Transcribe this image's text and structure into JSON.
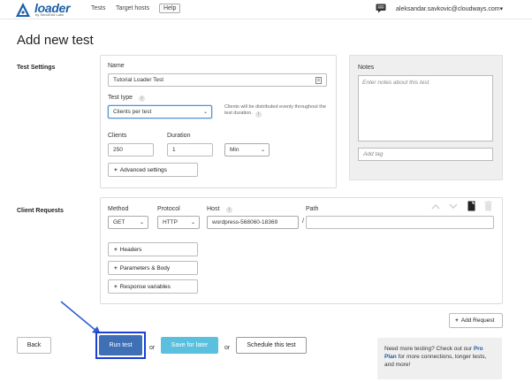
{
  "nav": {
    "brand": "loader",
    "brand_sub": "by SendGrid Labs",
    "tests": "Tests",
    "target_hosts": "Target hosts",
    "help": "Help",
    "user": "aleksandar.savkovic@cloudways.com",
    "user_caret": "▾"
  },
  "page": {
    "title": "Add new test"
  },
  "test_settings": {
    "section": "Test Settings",
    "name_label": "Name",
    "name_value": "Tutorial Loader Test",
    "test_type_label": "Test type",
    "test_type_value": "Clients per test",
    "test_type_hint": "Clients will be distributed evenly throughout the test duration.",
    "clients_label": "Clients",
    "clients_value": "250",
    "duration_label": "Duration",
    "duration_value": "1",
    "duration_unit": "Min",
    "advanced": "Advanced settings"
  },
  "notes": {
    "label": "Notes",
    "placeholder": "Enter notes about this test",
    "tag_placeholder": "Add tag"
  },
  "client_requests": {
    "section": "Client Requests",
    "method_label": "Method",
    "method_value": "GET",
    "protocol_label": "Protocol",
    "protocol_value": "HTTP",
    "host_label": "Host",
    "host_value": "wordpress-568060-18369",
    "path_label": "Path",
    "slash": "/",
    "headers": "Headers",
    "params_body": "Parameters & Body",
    "response_vars": "Response variables",
    "add_request": "Add Request"
  },
  "actions": {
    "back": "Back",
    "run_test": "Run test",
    "or": "or",
    "save_later": "Save for later",
    "schedule": "Schedule this test"
  },
  "promo": {
    "text_before": "Need more testing? Check out our",
    "plan_link": "Pro Plan",
    "text_after": "for more connections, longer tests, and more!"
  },
  "colors": {
    "brand": "#1b5fa8",
    "run_button": "#3f70b6",
    "save_button": "#5bc0de",
    "highlight_arrow": "#2f5fd0"
  }
}
